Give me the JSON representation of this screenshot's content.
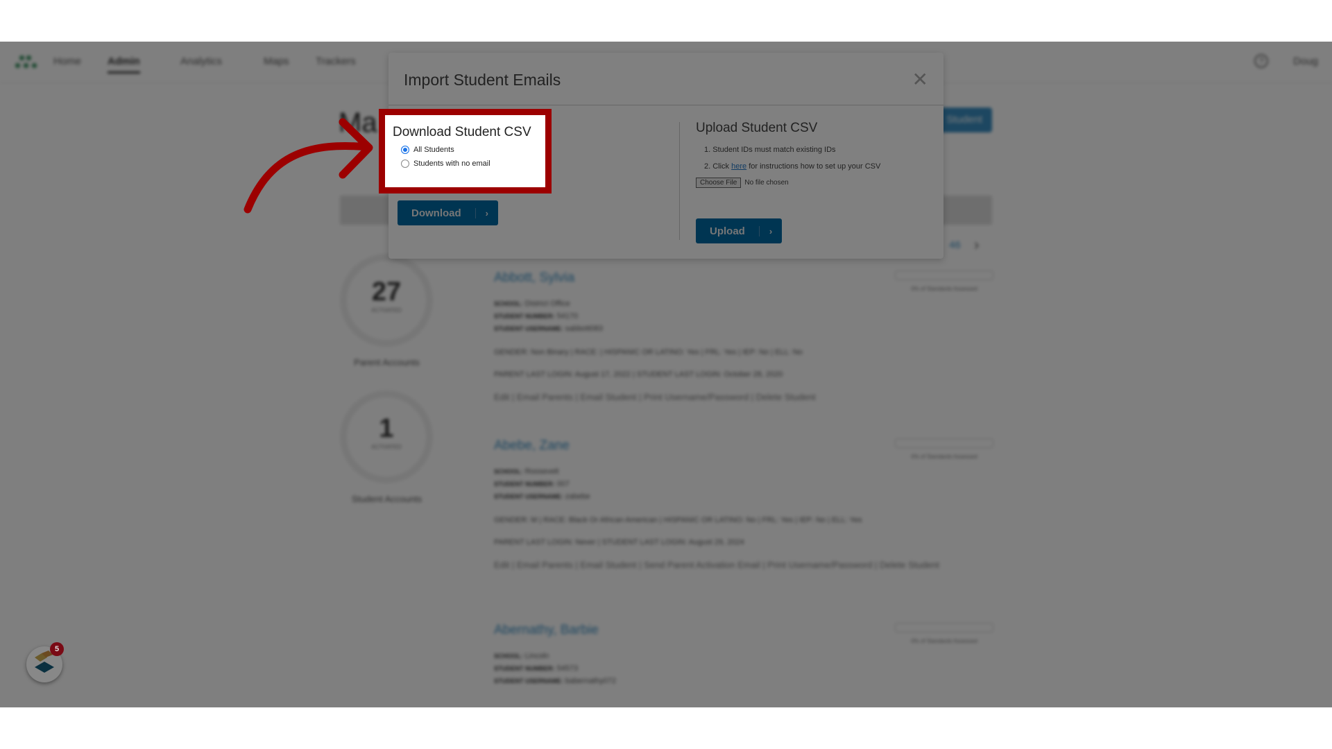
{
  "nav": {
    "items": [
      "Home",
      "Admin",
      "Analytics",
      "Maps",
      "Trackers"
    ],
    "active": "Admin",
    "user": "Doug"
  },
  "page": {
    "title": "Ma",
    "add_button": "Student",
    "pagination_last": "46"
  },
  "gauges": [
    {
      "value": "27",
      "unit": "%",
      "sub": "ACTIVATED",
      "caption": "Parent Accounts"
    },
    {
      "value": "1",
      "unit": "%",
      "sub": "ACTIVATED",
      "caption": "Student Accounts"
    }
  ],
  "students": [
    {
      "name": "Abbott, Sylvia",
      "school": "District Office",
      "number": "54170",
      "username": "sabbott083",
      "line1": "GENDER: Non Binary | RACE: | HISPANIC OR LATINO: Yes | FRL: Yes | IEP: No | ELL: No",
      "line2": "PARENT LAST LOGIN: August 17, 2022 | STUDENT LAST LOGIN: October 28, 2020",
      "actions": "Edit | Email Parents | Email Student | Print Username/Password | Delete Student",
      "progress": "0% of Standards Assessed"
    },
    {
      "name": "Abebe, Zane",
      "school": "Roosevelt",
      "number": "007",
      "username": "zabebe",
      "line1": "GENDER: M | RACE: Black Or African American | HISPANIC OR LATINO: No | FRL: Yes | IEP: No | ELL: Yes",
      "line2": "PARENT LAST LOGIN: Never | STUDENT LAST LOGIN: August 29, 2024",
      "actions": "Edit | Email Parents | Email Student | Send Parent Activation Email | Print Username/Password | Delete Student",
      "progress": "0% of Standards Assessed"
    },
    {
      "name": "Abernathy, Barbie",
      "school": "Lincoln",
      "number": "54573",
      "username": "babernathy072",
      "line1": "",
      "line2": "",
      "actions": "",
      "progress": "0% of Standards Assessed"
    }
  ],
  "labels": {
    "school": "School:",
    "number": "Student Number:",
    "username": "Student Username:"
  },
  "widget": {
    "badge": "5"
  },
  "modal": {
    "title": "Import Student Emails",
    "download": {
      "heading": "Download Student CSV",
      "options": [
        "All Students",
        "Students with no email"
      ],
      "selected": "All Students",
      "button": "Download"
    },
    "upload": {
      "heading": "Upload Student CSV",
      "step1": "1. Student IDs must match existing IDs",
      "step2_pre": "2. Click",
      "step2_link": "here",
      "step2_post": "for instructions how to set up your CSV",
      "choose_file": "Choose File",
      "no_file": "No file chosen",
      "button": "Upload"
    }
  },
  "colors": {
    "highlight": "#9c0000",
    "primary_button": "#003552",
    "overlay": "rgba(0,0,0,0.5)"
  }
}
